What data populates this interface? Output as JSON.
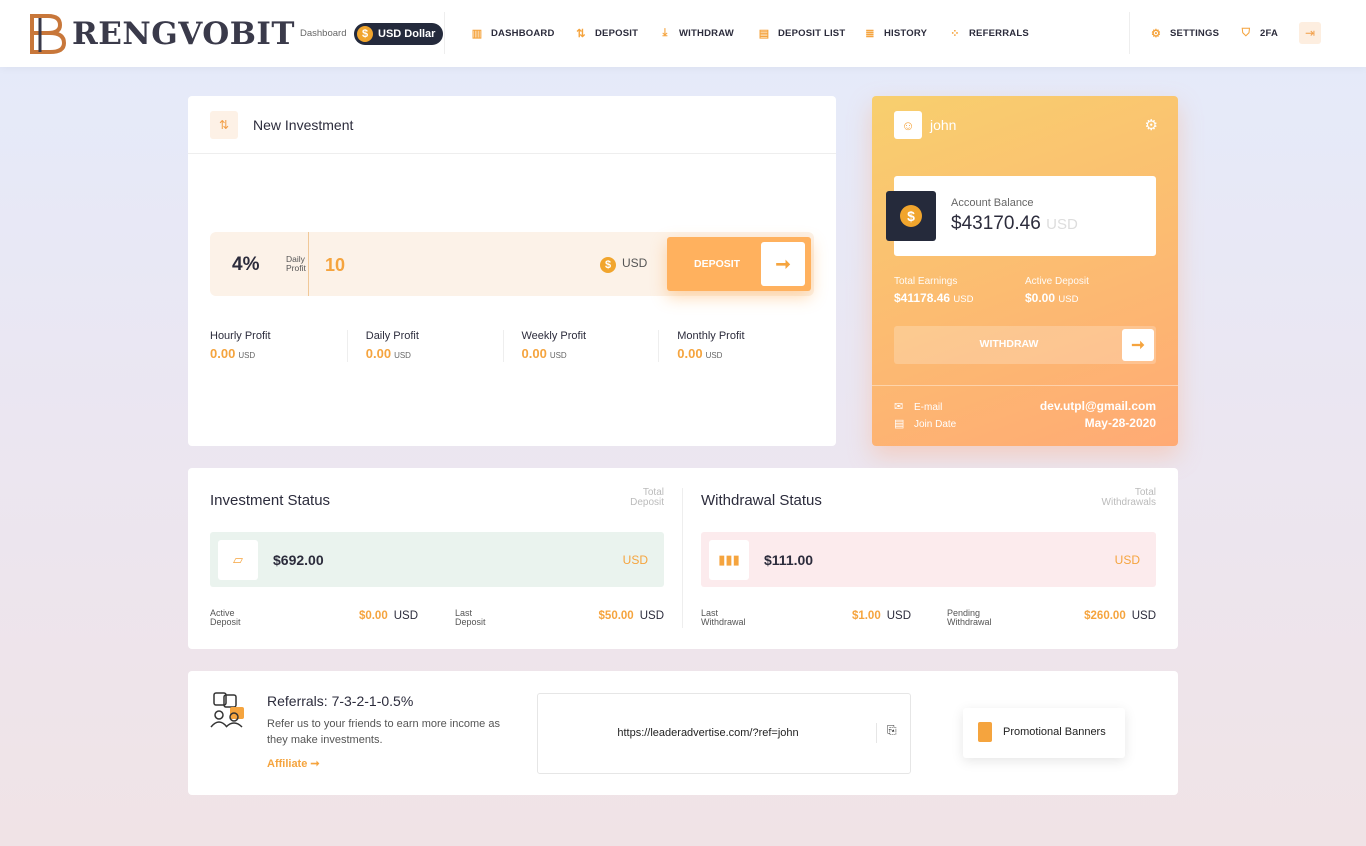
{
  "brand": {
    "name": "RENGVOBIT"
  },
  "header": {
    "dashboard_label": "Dashboard",
    "currency": "USD Dollar"
  },
  "nav": [
    {
      "label": "DASHBOARD",
      "icon": "dashboard-icon"
    },
    {
      "label": "DEPOSIT",
      "icon": "deposit-icon"
    },
    {
      "label": "WITHDRAW",
      "icon": "withdraw-icon"
    },
    {
      "label": "DEPOSIT LIST",
      "icon": "deposit-list-icon"
    },
    {
      "label": "HISTORY",
      "icon": "history-icon"
    },
    {
      "label": "REFERRALS",
      "icon": "referrals-icon"
    }
  ],
  "nav_right": [
    {
      "label": "SETTINGS",
      "icon": "settings-icon"
    },
    {
      "label": "2FA",
      "icon": "shield-icon"
    }
  ],
  "investment": {
    "title": "New Investment",
    "rate": "4%",
    "rate_sub_1": "Daily",
    "rate_sub_2": "Profit",
    "amount": "10",
    "currency": "USD",
    "deposit_label": "DEPOSIT",
    "profits": [
      {
        "label": "Hourly Profit",
        "value": "0.00",
        "unit": "USD"
      },
      {
        "label": "Daily Profit",
        "value": "0.00",
        "unit": "USD"
      },
      {
        "label": "Weekly Profit",
        "value": "0.00",
        "unit": "USD"
      },
      {
        "label": "Monthly Profit",
        "value": "0.00",
        "unit": "USD"
      }
    ]
  },
  "user": {
    "name": "john",
    "balance_label": "Account Balance",
    "balance": "$43170.46",
    "balance_unit": "USD",
    "total_earnings_label": "Total Earnings",
    "total_earnings": "$41178.46",
    "total_earnings_unit": "USD",
    "active_deposit_label": "Active Deposit",
    "active_deposit": "$0.00",
    "active_deposit_unit": "USD",
    "withdraw_label": "WITHDRAW",
    "email_label": "E-mail",
    "email": "dev.utpl@gmail.com",
    "join_label": "Join Date",
    "join_date": "May-28-2020"
  },
  "investment_status": {
    "title": "Investment Status",
    "total_1": "Total",
    "total_2": "Deposit",
    "amount": "$692.00",
    "unit": "USD",
    "a_label_1": "Active",
    "a_label_2": "Deposit",
    "a_value": "$0.00",
    "a_unit": "USD",
    "b_label_1": "Last",
    "b_label_2": "Deposit",
    "b_value": "$50.00",
    "b_unit": "USD"
  },
  "withdrawal_status": {
    "title": "Withdrawal Status",
    "total_1": "Total",
    "total_2": "Withdrawals",
    "amount": "$111.00",
    "unit": "USD",
    "a_label_1": "Last",
    "a_label_2": "Withdrawal",
    "a_value": "$1.00",
    "a_unit": "USD",
    "b_label_1": "Pending",
    "b_label_2": "Withdrawal",
    "b_value": "$260.00",
    "b_unit": "USD"
  },
  "referral": {
    "title": "Referrals: 7-3-2-1-0.5%",
    "text": "Refer us to your friends to earn more income as they make investments.",
    "affiliate": "Affiliate ➞",
    "link": "https://leaderadvertise.com/?ref=john",
    "promo": "Promotional Banners"
  },
  "colors": {
    "accent": "#f5a43e",
    "dark": "#252a3b",
    "invest_bg": "#eaf3ee",
    "withdraw_bg": "#fcebed"
  }
}
